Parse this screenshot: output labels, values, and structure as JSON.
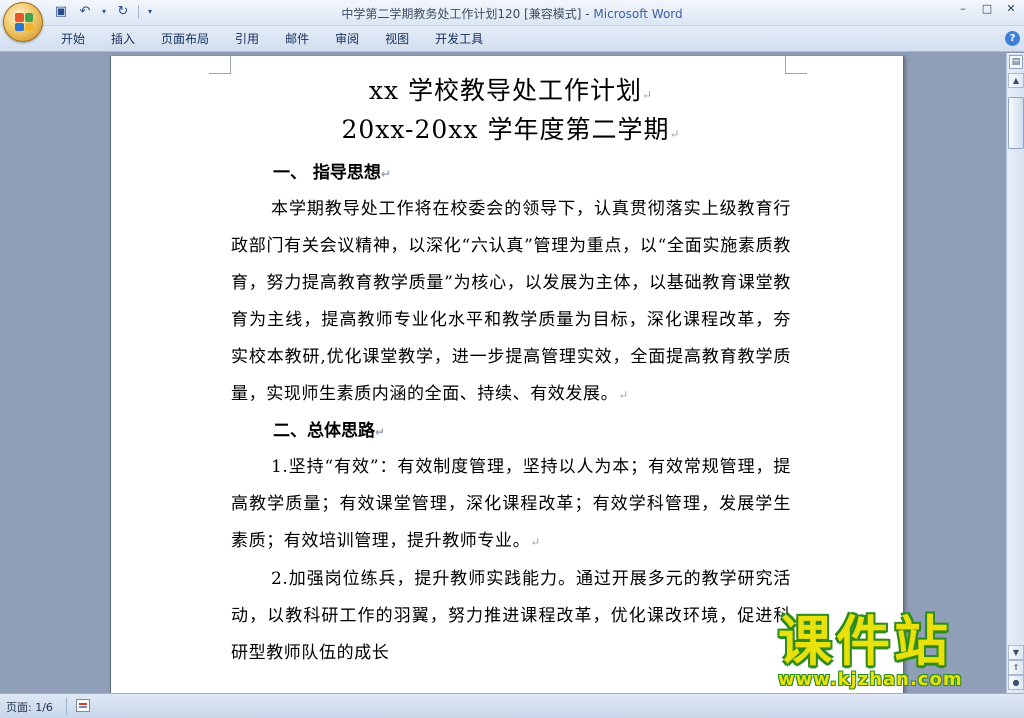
{
  "window": {
    "title_doc": "中学第二学期教务处工作计划120 [兼容模式] - ",
    "title_app": "Microsoft Word",
    "controls": [
      "–",
      "□",
      "✕"
    ]
  },
  "quick_access": {
    "save_icon": "save-icon",
    "undo_icon": "undo-icon",
    "redo_icon": "redo-icon"
  },
  "ribbon": {
    "tabs": [
      "开始",
      "插入",
      "页面布局",
      "引用",
      "邮件",
      "审阅",
      "视图",
      "开发工具"
    ],
    "help": "?"
  },
  "document": {
    "title": "xx 学校教导处工作计划",
    "subtitle": "20xx-20xx 学年度第二学期",
    "sections": [
      {
        "heading": "一、  指导思想"
      },
      {
        "heading": "二、总体思路"
      }
    ],
    "paragraphs": [
      "本学期教导处工作将在校委会的领导下，认真贯彻落实上级教育行政部门有关会议精神，以深化“六认真”管理为重点，以“全面实施素质教育，努力提高教育教学质量”为核心，以发展为主体，以基础教育课堂教育为主线，提高教师专业化水平和教学质量为目标，深化课程改革，夯实校本教研,优化课堂教学，进一步提高管理实效，全面提高教育教学质量，实现师生素质内涵的全面、持续、有效发展。",
      "1.坚持“有效”：有效制度管理，坚持以人为本；有效常规管理，提高教学质量；有效课堂管理，深化课程改革；有效学科管理，发展学生素质；有效培训管理，提升教师专业。",
      "2.加强岗位练兵，提升教师实践能力。通过开展多元的教学研究活动，以教科研工作的羽翼，努力推进课程改革，优化课改环境，促进科研型教师队伍的成长"
    ],
    "para_mark": "↵"
  },
  "watermark": {
    "big": "课件站",
    "url": "www.kjzhan.com"
  },
  "statusbar": {
    "page_label": "页面: 1/6"
  }
}
